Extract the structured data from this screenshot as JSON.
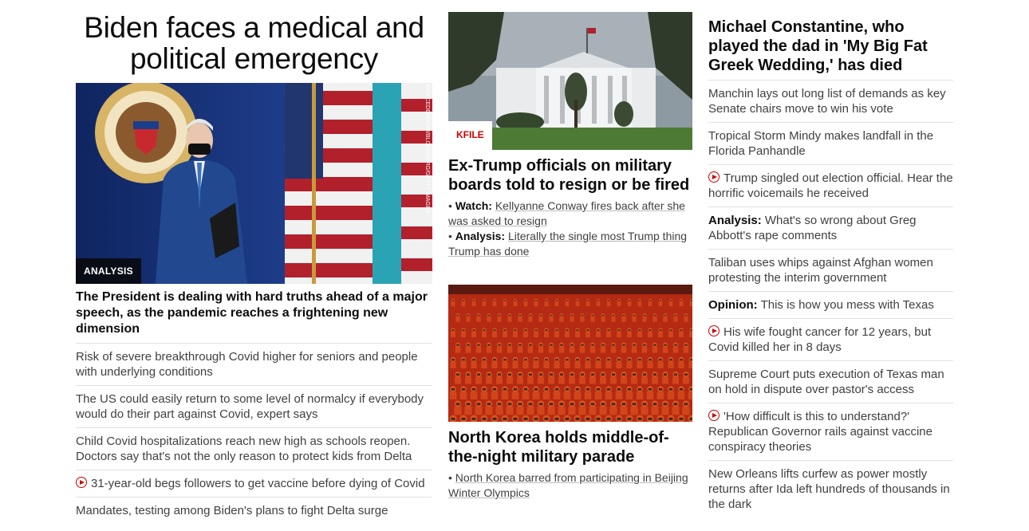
{
  "left": {
    "headline": "Biden faces a medical and political emergency",
    "image_watermark": "KEN CEDENO/UPI/BLOOMBERG/GETTY IMAGES",
    "badge": "ANALYSIS",
    "subhead": "The President is dealing with hard truths ahead of a major speech, as the pandemic reaches a frightening new dimension",
    "items": [
      {
        "text": "Risk of severe breakthrough Covid higher for seniors and people with underlying conditions"
      },
      {
        "text": "The US could easily return to some level of normalcy if everybody would do their part against Covid, expert says"
      },
      {
        "text": "Child Covid hospitalizations reach new high as schools reopen. Doctors say that's not the only reason to protect kids from Delta"
      },
      {
        "text": "31-year-old begs followers to get vaccine before dying of Covid",
        "video": true
      },
      {
        "text": "Mandates, testing among Biden's plans to fight Delta surge"
      }
    ]
  },
  "middle": {
    "story1": {
      "badge": "KFILE",
      "title": "Ex-Trump officials on military boards told to resign or be fired",
      "bullets": [
        {
          "prefix": "Watch:",
          "text": "Kellyanne Conway fires back after she was asked to resign"
        },
        {
          "prefix": "Analysis:",
          "text": "Literally the single most Trump thing Trump has done"
        }
      ]
    },
    "story2": {
      "title": "North Korea holds middle-of-the-night military parade",
      "bullets": [
        {
          "text": "North Korea barred from participating in Beijing Winter Olympics"
        }
      ]
    }
  },
  "right": {
    "top_title": "Michael Constantine, who played the dad in 'My Big Fat Greek Wedding,' has died",
    "items": [
      {
        "text": "Manchin lays out long list of demands as key Senate chairs move to win his vote"
      },
      {
        "text": "Tropical Storm Mindy makes landfall in the Florida Panhandle"
      },
      {
        "text": "Trump singled out election official. Hear the horrific voicemails he received",
        "video": true
      },
      {
        "prefix": "Analysis:",
        "text": "What's so wrong about Greg Abbott's rape comments"
      },
      {
        "text": "Taliban uses whips against Afghan women protesting the interim government"
      },
      {
        "prefix": "Opinion:",
        "text": "This is how you mess with Texas"
      },
      {
        "text": "His wife fought cancer for 12 years, but Covid killed her in 8 days",
        "video": true
      },
      {
        "text": "Supreme Court puts execution of Texas man on hold in dispute over pastor's access"
      },
      {
        "text": "'How difficult is this to understand?' Republican Governor rails against vaccine conspiracy theories",
        "video": true
      },
      {
        "text": "New Orleans lifts curfew as power mostly returns after Ida left hundreds of thousands in the dark"
      }
    ]
  }
}
